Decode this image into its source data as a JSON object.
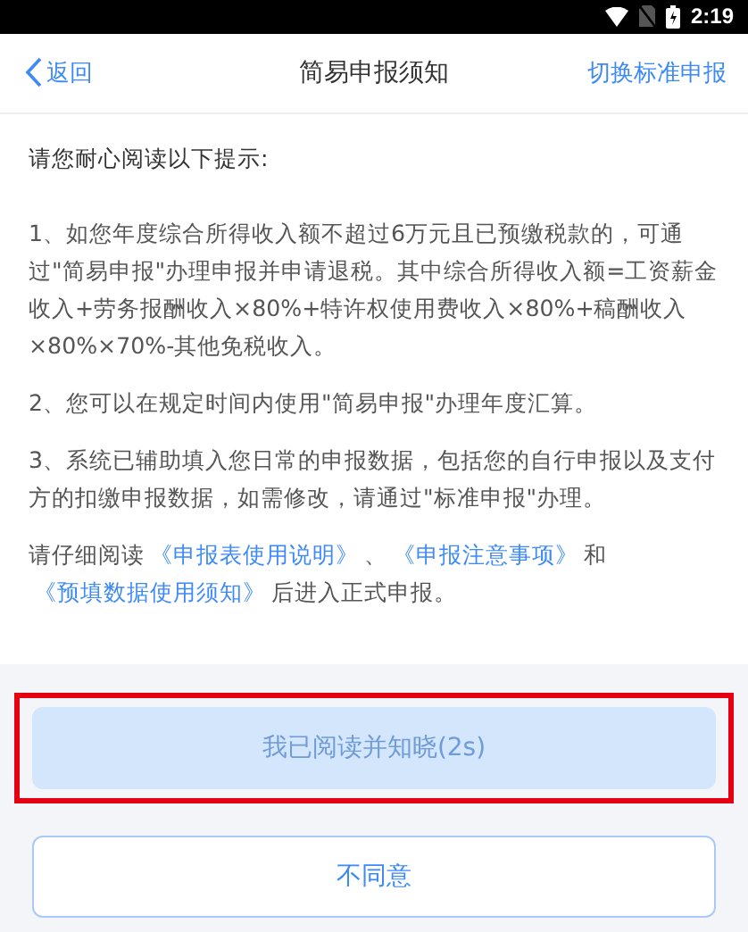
{
  "status_bar": {
    "time": "2:19"
  },
  "nav": {
    "back": "返回",
    "title": "简易申报须知",
    "action": "切换标准申报"
  },
  "intro": "请您耐心阅读以下提示:",
  "tips": [
    "1、如您年度综合所得收入额不超过6万元且已预缴税款的，可通过\"简易申报\"办理申报并申请退税。其中综合所得收入额=工资薪金收入+劳务报酬收入×80%+特许权使用费收入×80%+稿酬收入×80%×70%-其他免税收入。",
    "2、您可以在规定时间内使用\"简易申报\"办理年度汇算。",
    "3、系统已辅助填入您日常的申报数据，包括您的自行申报以及支付方的扣缴申报数据，如需修改，请通过\"标准申报\"办理。"
  ],
  "notice": [
    {
      "kind": "text",
      "text": "请仔细阅读"
    },
    {
      "kind": "link",
      "text": "《申报表使用说明》"
    },
    {
      "kind": "text",
      "text": "、"
    },
    {
      "kind": "link",
      "text": "《申报注意事项》"
    },
    {
      "kind": "text",
      "text": "和"
    },
    {
      "kind": "link",
      "text": "《预填数据使用须知》"
    },
    {
      "kind": "text",
      "text": "后进入正式申报。"
    }
  ],
  "buttons": [
    {
      "kind": "primary",
      "label": "我已阅读并知晓(2s)",
      "disabled": true,
      "highlighted": true
    },
    {
      "kind": "outline",
      "label": "不同意",
      "disabled": false,
      "highlighted": false
    }
  ]
}
